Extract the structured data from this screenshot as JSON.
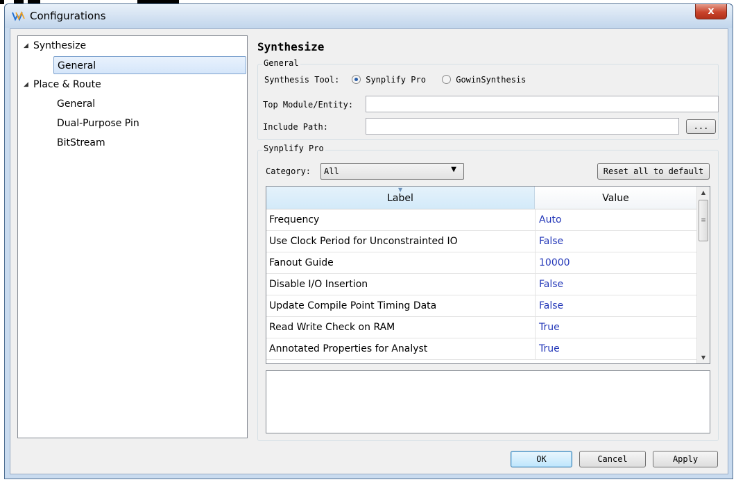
{
  "window": {
    "title": "Configurations",
    "close_label": "x"
  },
  "tree": {
    "items": [
      {
        "label": "Synthesize",
        "expanded": true
      },
      {
        "label": "General",
        "selected": true
      },
      {
        "label": "Place & Route",
        "expanded": true
      },
      {
        "label": "General"
      },
      {
        "label": "Dual-Purpose Pin"
      },
      {
        "label": "BitStream"
      }
    ]
  },
  "main": {
    "section_title": "Synthesize",
    "general_group": {
      "label": "General",
      "synthesis_tool_label": "Synthesis Tool:",
      "options": [
        "Synplify Pro",
        "GowinSynthesis"
      ],
      "selected_option": "Synplify Pro",
      "top_module_label": "Top Module/Entity:",
      "top_module_value": "",
      "include_path_label": "Include Path:",
      "include_path_value": "",
      "browse_label": "..."
    },
    "synplify_group": {
      "label": "Synplify Pro",
      "category_label": "Category:",
      "category_value": "All",
      "reset_label": "Reset all to default"
    },
    "table": {
      "columns": [
        "Label",
        "Value"
      ],
      "rows": [
        {
          "label": "Frequency",
          "value": "Auto"
        },
        {
          "label": "Use Clock Period for Unconstrainted IO",
          "value": "False"
        },
        {
          "label": "Fanout Guide",
          "value": "10000"
        },
        {
          "label": "Disable I/O Insertion",
          "value": "False"
        },
        {
          "label": "Update Compile Point Timing Data",
          "value": "False"
        },
        {
          "label": "Read Write Check on RAM",
          "value": "True"
        },
        {
          "label": "Annotated Properties for Analyst",
          "value": "True"
        }
      ]
    },
    "description": ""
  },
  "footer": {
    "ok_label": "OK",
    "cancel_label": "Cancel",
    "apply_label": "Apply"
  },
  "colors": {
    "value_text": "#2236b8",
    "selection": "#d5e6fa",
    "window_frame": "#c9dbef"
  }
}
